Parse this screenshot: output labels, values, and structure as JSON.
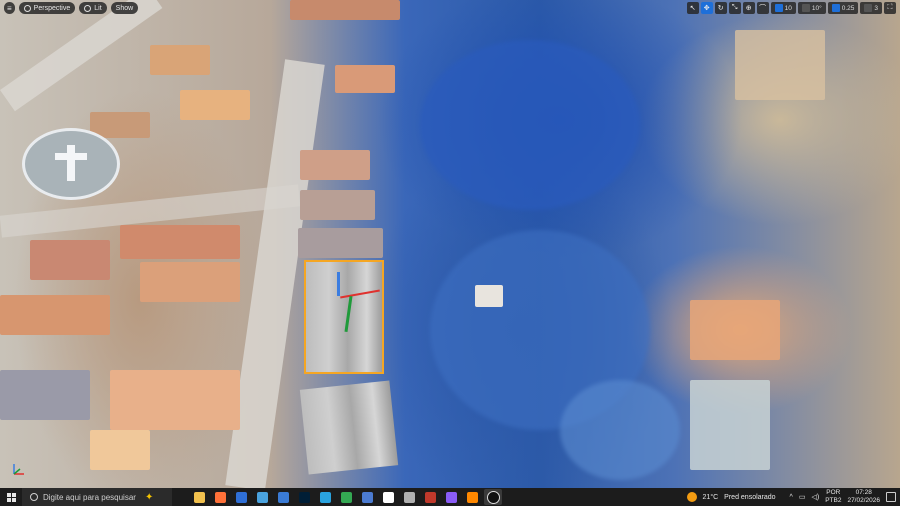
{
  "viewport": {
    "toolbar": {
      "perspective_label": "Perspective",
      "lit_label": "Lit",
      "show_label": "Show"
    },
    "right_toolbar": {
      "grid_snap_value": "10",
      "rotation_snap_value": "10°",
      "scale_snap_value": "0.25",
      "camera_speed_value": "3"
    }
  },
  "taskbar": {
    "search_placeholder": "Digite aqui para pesquisar",
    "apps": [
      {
        "name": "file-explorer",
        "color": "#f2c14e"
      },
      {
        "name": "firefox",
        "color": "#ff7139"
      },
      {
        "name": "firefox-alt",
        "color": "#2f6fd6"
      },
      {
        "name": "notepad",
        "color": "#4aa3df"
      },
      {
        "name": "web-browser",
        "color": "#3a7bd5"
      },
      {
        "name": "photoshop",
        "color": "#001e36"
      },
      {
        "name": "telegram",
        "color": "#2aa3df"
      },
      {
        "name": "chrome",
        "color": "#34a853"
      },
      {
        "name": "word-app",
        "color": "#4b7bd1"
      },
      {
        "name": "capcut",
        "color": "#ffffff"
      },
      {
        "name": "virtual-desktop",
        "color": "#b0b0b0"
      },
      {
        "name": "epic-games",
        "color": "#c0392b"
      },
      {
        "name": "github",
        "color": "#8a5cf6"
      },
      {
        "name": "vlc",
        "color": "#ff8800"
      },
      {
        "name": "unreal-engine",
        "color": "#111111"
      }
    ],
    "weather_temp": "21°C",
    "weather_desc": "Pred ensolarado",
    "lang_top": "POR",
    "lang_bottom": "PTB2",
    "time": "07:28",
    "date": "27/02/2026"
  }
}
